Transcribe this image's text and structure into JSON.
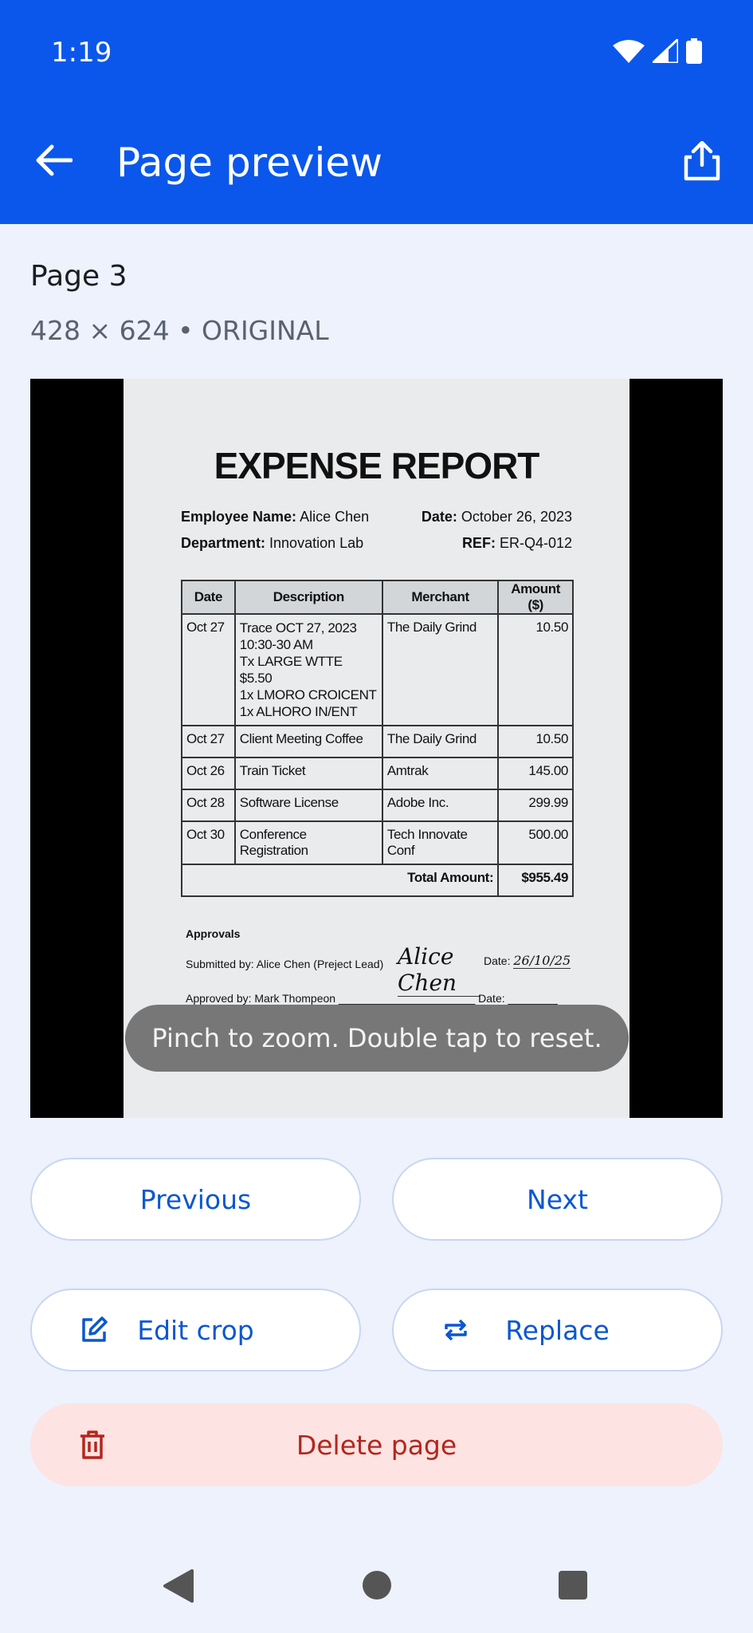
{
  "status_bar": {
    "time": "1:19",
    "icons": [
      "wifi-icon",
      "signal-icon",
      "battery-icon"
    ]
  },
  "app_bar": {
    "title": "Page preview",
    "back_icon": "arrow-left-icon",
    "share_icon": "share-icon",
    "background": "#0b57eb"
  },
  "page_info": {
    "title": "Page 3",
    "meta": "428 × 624 • ORIGINAL"
  },
  "document": {
    "title": "EXPENSE REPORT",
    "employee_label": "Employee Name:",
    "employee_value": "Alice Chen",
    "department_label": "Department:",
    "department_value": "Innovation Lab",
    "date_label": "Date:",
    "date_value": "October 26, 2023",
    "ref_label": "REF:",
    "ref_value": "ER-Q4-012",
    "table": {
      "headers": [
        "Date",
        "Description",
        "Merchant",
        "Amount ($)"
      ],
      "rows": [
        {
          "date": "Oct 27",
          "description_lines": [
            "Trace OCT 27, 2023",
            "10:30-30 AM",
            "Tx LARGE WTTE $5.50",
            "1x LMORO CROICENT",
            "1x ALHORO IN/ENT"
          ],
          "merchant": "The Daily Grind",
          "amount": "10.50"
        },
        {
          "date": "Oct 27",
          "description_lines": [
            "Client Meeting Coffee"
          ],
          "merchant": "The Daily Grind",
          "amount": "10.50"
        },
        {
          "date": "Oct 26",
          "description_lines": [
            "Train Ticket"
          ],
          "merchant": "Amtrak",
          "amount": "145.00"
        },
        {
          "date": "Oct 28",
          "description_lines": [
            "Software License"
          ],
          "merchant": "Adobe Inc.",
          "amount": "299.99"
        },
        {
          "date": "Oct 30",
          "description_lines": [
            "Conference Registration"
          ],
          "merchant": "Tech Innovate Conf",
          "amount": "500.00"
        }
      ],
      "total_label": "Total Amount:",
      "total_value": "$955.49"
    },
    "approvals_heading": "Approvals",
    "submitted_by": "Submitted by: Alice Chen (Preject Lead)",
    "signature": "Alice Chen",
    "submitted_date_label": "Date:",
    "submitted_date_value": "26/10/25",
    "approved_by": "Approved by: Mark Thompeon",
    "approved_date_label": "Date:"
  },
  "toast": "Pinch to zoom. Double tap to reset.",
  "actions": {
    "previous": "Previous",
    "next": "Next",
    "edit_crop": "Edit crop",
    "replace": "Replace",
    "delete_page": "Delete page"
  },
  "colors": {
    "primary": "#0b57d0",
    "danger": "#b3261e",
    "danger_bg": "#fde3e1",
    "page_bg": "#edf2fd"
  },
  "nav_bar": [
    "back-triangle-icon",
    "home-circle-icon",
    "recents-square-icon"
  ]
}
